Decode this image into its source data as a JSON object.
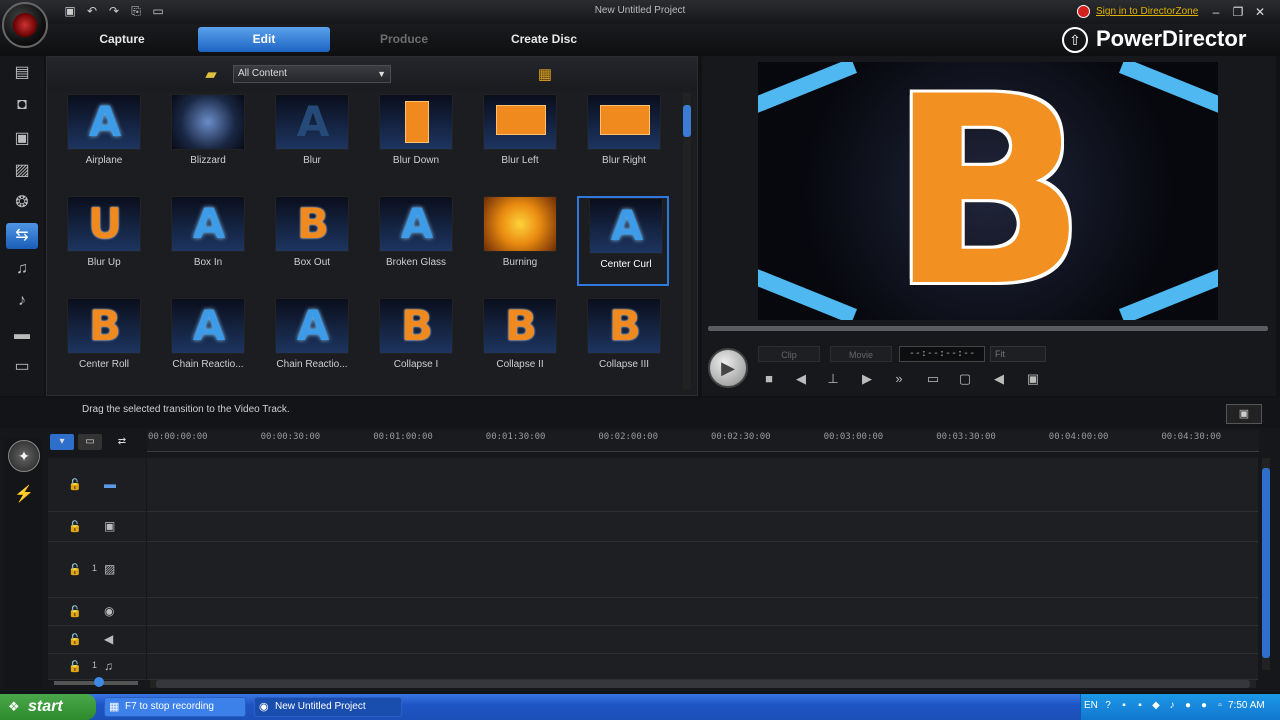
{
  "window": {
    "title": "New Untitled Project",
    "signin_label": "Sign in to DirectorZone",
    "brand": "PowerDirector",
    "minimize": "–",
    "restore": "❐",
    "close": "✕"
  },
  "quick_access": [
    "▣",
    "↶",
    "↷",
    "⎘",
    "▭"
  ],
  "tabs": [
    {
      "label": "Capture",
      "state": "normal"
    },
    {
      "label": "Edit",
      "state": "active"
    },
    {
      "label": "Produce",
      "state": "disabled"
    },
    {
      "label": "Create Disc",
      "state": "normal"
    }
  ],
  "rooms": [
    {
      "icon": "media-room-icon",
      "glyph": "▤"
    },
    {
      "icon": "effect-room-icon",
      "glyph": "◘"
    },
    {
      "icon": "pip-room-icon",
      "glyph": "▣"
    },
    {
      "icon": "particle-room-icon",
      "glyph": "▨"
    },
    {
      "icon": "title-room-icon",
      "glyph": "❂"
    },
    {
      "icon": "transition-room-icon",
      "glyph": "⇆"
    },
    {
      "icon": "audio-mixing-room-icon",
      "glyph": "♫"
    },
    {
      "icon": "voice-over-room-icon",
      "glyph": "♪"
    },
    {
      "icon": "chapter-room-icon",
      "glyph": "▬"
    },
    {
      "icon": "subtitle-room-icon",
      "glyph": "▭"
    }
  ],
  "library": {
    "filter": "All Content",
    "items": [
      {
        "label": "Airplane",
        "glyph": "A",
        "style": "blue"
      },
      {
        "label": "Blizzard",
        "glyph": "",
        "style": "blue"
      },
      {
        "label": "Blur",
        "glyph": "A",
        "style": "dim"
      },
      {
        "label": "Blur Down",
        "glyph": "",
        "style": "orange"
      },
      {
        "label": "Blur Left",
        "glyph": "",
        "style": "orange"
      },
      {
        "label": "Blur Right",
        "glyph": "",
        "style": "orange"
      },
      {
        "label": "Blur Up",
        "glyph": "U",
        "style": "orange"
      },
      {
        "label": "Box In",
        "glyph": "A",
        "style": "blue"
      },
      {
        "label": "Box Out",
        "glyph": "B",
        "style": "orange"
      },
      {
        "label": "Broken Glass",
        "glyph": "A",
        "style": "blue"
      },
      {
        "label": "Burning",
        "glyph": "",
        "style": "orange"
      },
      {
        "label": "Center Curl",
        "glyph": "A",
        "style": "blue"
      },
      {
        "label": "Center Roll",
        "glyph": "B",
        "style": "orange"
      },
      {
        "label": "Chain Reactio...",
        "glyph": "A",
        "style": "blue"
      },
      {
        "label": "Chain Reactio...",
        "glyph": "A",
        "style": "blue"
      },
      {
        "label": "Collapse I",
        "glyph": "B",
        "style": "orange"
      },
      {
        "label": "Collapse II",
        "glyph": "B",
        "style": "orange"
      },
      {
        "label": "Collapse III",
        "glyph": "B",
        "style": "orange"
      }
    ],
    "selected_index": 11
  },
  "preview": {
    "letter": "B",
    "clip_label": "Clip",
    "movie_label": "Movie",
    "timecode": "--:--:--:--",
    "fit_label": "Fit"
  },
  "status": {
    "text": "Drag the selected transition to the Video Track."
  },
  "timeline": {
    "ticks": [
      "00:00:00:00",
      "00:00:30:00",
      "00:01:00:00",
      "00:01:30:00",
      "00:02:00:00",
      "00:02:30:00",
      "00:03:00:00",
      "00:03:30:00",
      "00:04:00:00",
      "00:04:30:00"
    ],
    "tracks": [
      {
        "icon": "video-track-icon",
        "glyph": "▬",
        "number": ""
      },
      {
        "icon": "effect-track-icon",
        "glyph": "▣",
        "number": ""
      },
      {
        "icon": "pip-track-icon",
        "glyph": "▨",
        "number": "1"
      },
      {
        "icon": "title-track-icon",
        "glyph": "◉",
        "number": ""
      },
      {
        "icon": "voice-track-icon",
        "glyph": "◀",
        "number": ""
      },
      {
        "icon": "music-track-icon",
        "glyph": "♫",
        "number": "1"
      }
    ]
  },
  "taskbar": {
    "start": "start",
    "items": [
      "F7 to stop recording",
      "New Untitled Project"
    ],
    "lang": "EN",
    "clock": "7:50 AM"
  }
}
